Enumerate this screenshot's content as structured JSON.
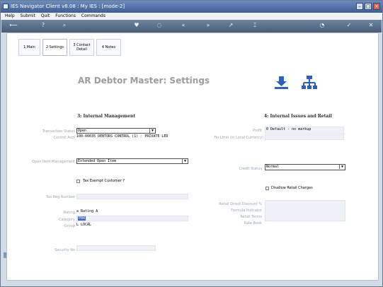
{
  "window": {
    "title": "IES Navigator Client v8.08 : My IES :       [mode-2]"
  },
  "menu": [
    "Help",
    "Submit",
    "Quit",
    "Functions",
    "Commands"
  ],
  "toolbar": {
    "icons": [
      "back-arrow-icon",
      "help-icon",
      "search-icon",
      "heart-icon",
      "gear-icon",
      "rewind-icon",
      "fast-forward-icon",
      "arrow-icon",
      "text-icon",
      "refresh-icon",
      "check-icon",
      "close-icon"
    ]
  },
  "tabs": [
    {
      "label": "1 Main"
    },
    {
      "label": "2 Settings"
    },
    {
      "label": "3 Contact Detail"
    },
    {
      "label": "4 Notes"
    }
  ],
  "page": {
    "title": "AR Debtor Master: Settings"
  },
  "sections": {
    "left": "3: Internal Management",
    "right": "4: Internal Issues and Retail"
  },
  "fields": {
    "transaction_status": {
      "label": "Transaction Status",
      "value": "Open"
    },
    "control_acct": {
      "label": "Control Acct",
      "value": "100-00035 DEBTORS CONTROL (1) : PRIVATE LED"
    },
    "open_item_mgmt": {
      "label": "Open Item Management",
      "value": "Extended Open Item"
    },
    "tax_exempt": {
      "label": "Tax Exempt Customer ?"
    },
    "tax_reg": {
      "label": "Tax Reg Number",
      "value": ""
    },
    "rating": {
      "label": "Rating",
      "value": "a Rating A"
    },
    "category": {
      "label": "Category",
      "value": "P04"
    },
    "group": {
      "label": "Group",
      "value": "L LOCAL"
    },
    "security": {
      "label": "Security No",
      "value": ""
    },
    "profit": {
      "label": "Profit",
      "value": "0 Default - no markup"
    },
    "fin_limit": {
      "label": "Fin Limit (in Local Currency)",
      "value": ""
    },
    "credit_status": {
      "label": "Credit Status",
      "value": "Normal"
    },
    "disallow_retail": {
      "label": "Disallow Retail Charges"
    },
    "retail_direct": {
      "label": "Retail Direct Discount %",
      "value": ""
    },
    "formula_indicator": {
      "label": "Formula Indicator",
      "value": ""
    },
    "retail_terms": {
      "label": "Retail Terms",
      "value": ""
    },
    "rate_book": {
      "label": "Rate Book",
      "value": ""
    }
  }
}
